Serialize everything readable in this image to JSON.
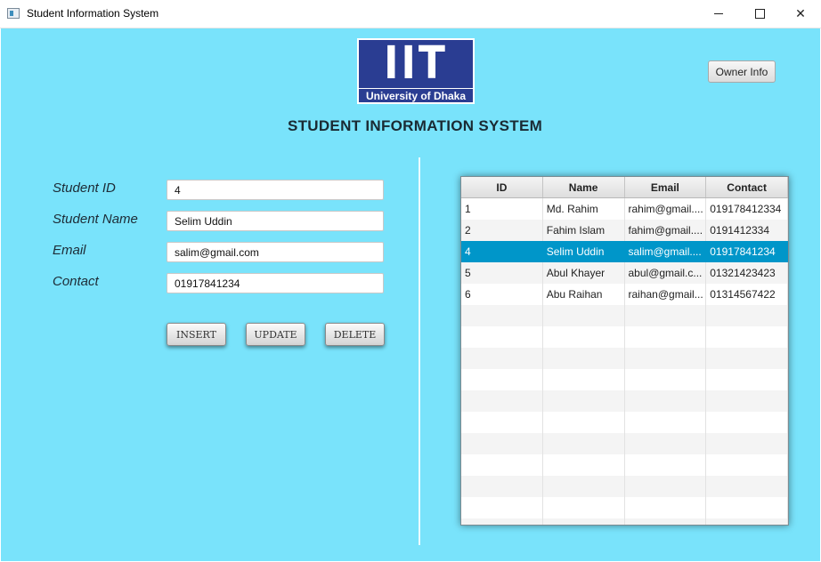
{
  "window": {
    "title": "Student Information System"
  },
  "header": {
    "logo_letters": "IIT",
    "logo_subtitle": "University of Dhaka",
    "owner_button": "Owner Info",
    "main_title": "STUDENT INFORMATION SYSTEM"
  },
  "form": {
    "student_id": {
      "label": "Student ID",
      "value": "4"
    },
    "student_name": {
      "label": "Student Name",
      "value": "Selim Uddin"
    },
    "email": {
      "label": "Email",
      "value": "salim@gmail.com"
    },
    "contact": {
      "label": "Contact",
      "value": "01917841234"
    },
    "buttons": {
      "insert": "INSERT",
      "update": "UPDATE",
      "delete": "DELETE"
    }
  },
  "table": {
    "columns": [
      "ID",
      "Name",
      "Email",
      "Contact"
    ],
    "rows": [
      [
        "1",
        "Md. Rahim",
        "rahim@gmail....",
        "019178412334"
      ],
      [
        "2",
        "Fahim Islam",
        "fahim@gmail....",
        "0191412334"
      ],
      [
        "4",
        "Selim Uddin",
        "salim@gmail....",
        "01917841234"
      ],
      [
        "5",
        "Abul Khayer",
        "abul@gmail.c...",
        "01321423423"
      ],
      [
        "6",
        "Abu Raihan",
        "raihan@gmail...",
        "01314567422"
      ]
    ],
    "selected_row_index": 2
  }
}
